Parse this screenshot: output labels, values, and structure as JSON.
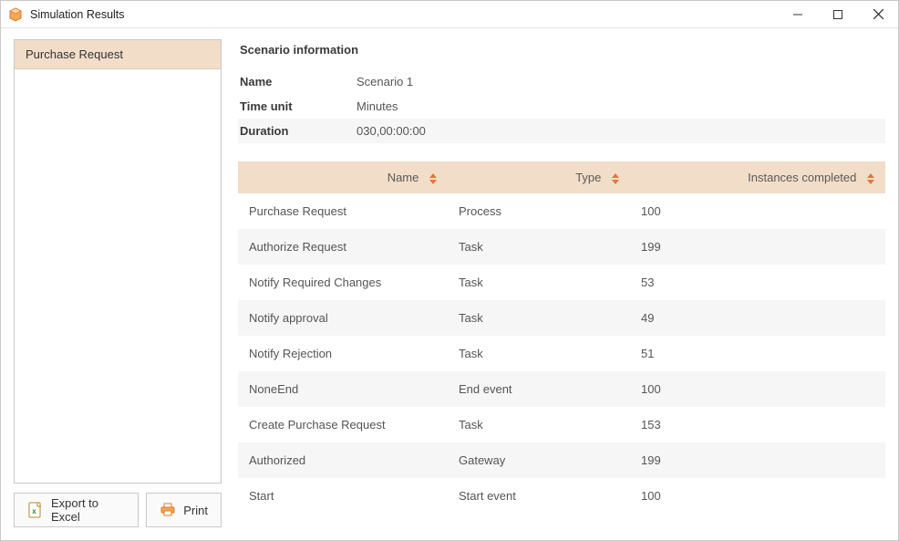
{
  "window": {
    "title": "Simulation Results"
  },
  "sidebar": {
    "items": [
      {
        "label": "Purchase Request"
      }
    ]
  },
  "actions": {
    "export_label": "Export to Excel",
    "print_label": "Print"
  },
  "section": {
    "title": "Scenario information"
  },
  "info": {
    "name_label": "Name",
    "name_value": "Scenario 1",
    "time_label": "Time unit",
    "time_value": "Minutes",
    "duration_label": "Duration",
    "duration_value": "030,00:00:00"
  },
  "table": {
    "headers": {
      "name": "Name",
      "type": "Type",
      "instances": "Instances completed"
    },
    "rows": [
      {
        "name": "Purchase Request",
        "type": "Process",
        "instances": "100"
      },
      {
        "name": "Authorize Request",
        "type": "Task",
        "instances": "199"
      },
      {
        "name": "Notify Required Changes",
        "type": "Task",
        "instances": "53"
      },
      {
        "name": "Notify approval",
        "type": "Task",
        "instances": "49"
      },
      {
        "name": "Notify Rejection",
        "type": "Task",
        "instances": "51"
      },
      {
        "name": "NoneEnd",
        "type": "End event",
        "instances": "100"
      },
      {
        "name": "Create Purchase Request",
        "type": "Task",
        "instances": "153"
      },
      {
        "name": "Authorized",
        "type": "Gateway",
        "instances": "199"
      },
      {
        "name": "Start",
        "type": "Start event",
        "instances": "100"
      }
    ]
  }
}
